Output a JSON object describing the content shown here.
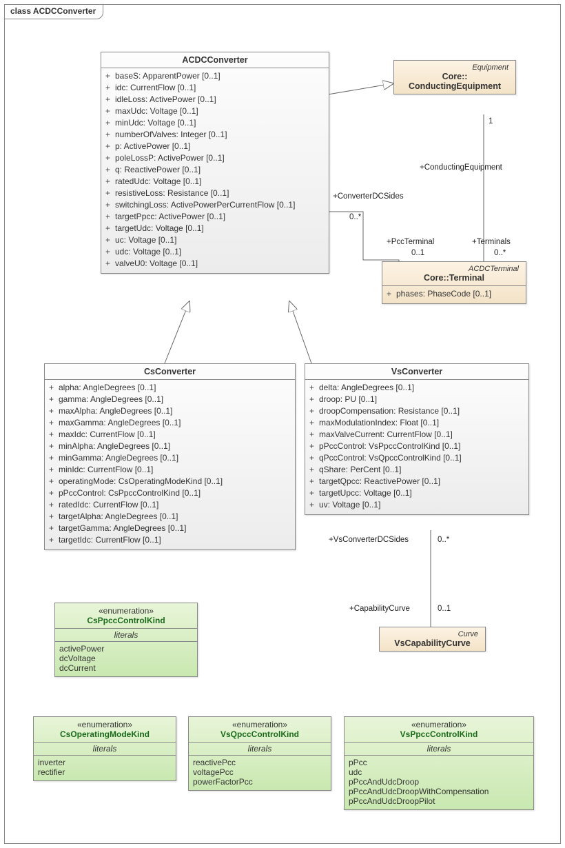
{
  "frame": {
    "title": "class ACDCConverter"
  },
  "acdc": {
    "name": "ACDCConverter",
    "attrs": [
      "baseS: ApparentPower [0..1]",
      "idc: CurrentFlow [0..1]",
      "idleLoss: ActivePower [0..1]",
      "maxUdc: Voltage [0..1]",
      "minUdc: Voltage [0..1]",
      "numberOfValves: Integer [0..1]",
      "p: ActivePower [0..1]",
      "poleLossP: ActivePower [0..1]",
      "q: ReactivePower [0..1]",
      "ratedUdc: Voltage [0..1]",
      "resistiveLoss: Resistance [0..1]",
      "switchingLoss: ActivePowerPerCurrentFlow [0..1]",
      "targetPpcc: ActivePower [0..1]",
      "targetUdc: Voltage [0..1]",
      "uc: Voltage [0..1]",
      "udc: Voltage [0..1]",
      "valveU0: Voltage [0..1]"
    ]
  },
  "condEq": {
    "stereo": "Equipment",
    "name": "Core::",
    "name2": "ConductingEquipment"
  },
  "terminal": {
    "stereo": "ACDCTerminal",
    "name": "Core::Terminal",
    "attr": "phases: PhaseCode [0..1]"
  },
  "cs": {
    "name": "CsConverter",
    "attrs": [
      "alpha: AngleDegrees [0..1]",
      "gamma: AngleDegrees [0..1]",
      "maxAlpha: AngleDegrees [0..1]",
      "maxGamma: AngleDegrees [0..1]",
      "maxIdc: CurrentFlow [0..1]",
      "minAlpha: AngleDegrees [0..1]",
      "minGamma: AngleDegrees [0..1]",
      "minIdc: CurrentFlow [0..1]",
      "operatingMode: CsOperatingModeKind [0..1]",
      "pPccControl: CsPpccControlKind [0..1]",
      "ratedIdc: CurrentFlow [0..1]",
      "targetAlpha: AngleDegrees [0..1]",
      "targetGamma: AngleDegrees [0..1]",
      "targetIdc: CurrentFlow [0..1]"
    ]
  },
  "vs": {
    "name": "VsConverter",
    "attrs": [
      "delta: AngleDegrees [0..1]",
      "droop: PU [0..1]",
      "droopCompensation: Resistance [0..1]",
      "maxModulationIndex: Float [0..1]",
      "maxValveCurrent: CurrentFlow [0..1]",
      "pPccControl: VsPpccControlKind [0..1]",
      "qPccControl: VsQpccControlKind [0..1]",
      "qShare: PerCent [0..1]",
      "targetQpcc: ReactivePower [0..1]",
      "targetUpcc: Voltage [0..1]",
      "uv: Voltage [0..1]"
    ]
  },
  "csPpcc": {
    "stereo": "«enumeration»",
    "name": "CsPpccControlKind",
    "lits": [
      "activePower",
      "dcVoltage",
      "dcCurrent"
    ]
  },
  "csOp": {
    "stereo": "«enumeration»",
    "name": "CsOperatingModeKind",
    "lits": [
      "inverter",
      "rectifier"
    ]
  },
  "vsQpcc": {
    "stereo": "«enumeration»",
    "name": "VsQpccControlKind",
    "lits": [
      "reactivePcc",
      "voltagePcc",
      "powerFactorPcc"
    ]
  },
  "vsPpcc": {
    "stereo": "«enumeration»",
    "name": "VsPpccControlKind",
    "lits": [
      "pPcc",
      "udc",
      "pPccAndUdcDroop",
      "pPccAndUdcDroopWithCompensation",
      "pPccAndUdcDroopPilot"
    ]
  },
  "vsCap": {
    "stereo": "Curve",
    "name": "VsCapabilityCurve"
  },
  "labels": {
    "convDCSides": "+ConverterDCSides",
    "zeroStar1": "0..*",
    "pccTerm": "+PccTerminal",
    "card01a": "0..1",
    "condEq": "+ConductingEquipment",
    "one": "1",
    "terminals": "+Terminals",
    "zeroStar2": "0..*",
    "vsConvDCSides": "+VsConverterDCSides",
    "zeroStar3": "0..*",
    "capCurve": "+CapabilityCurve",
    "card01b": "0..1",
    "literals": "literals"
  }
}
